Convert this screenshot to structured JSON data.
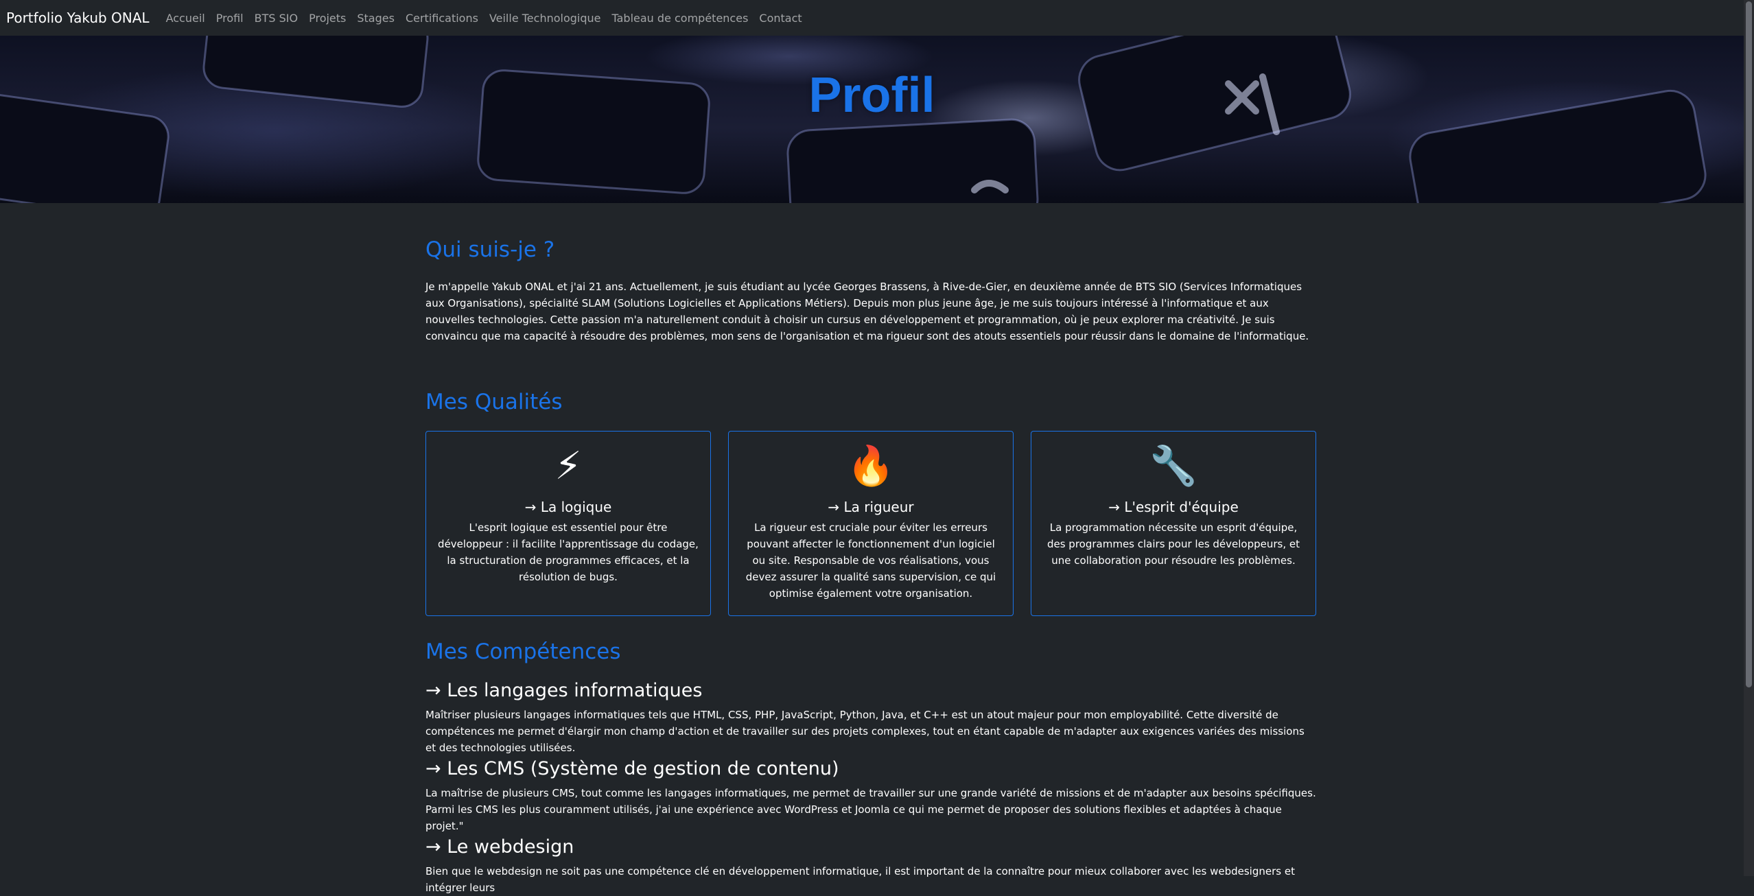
{
  "navbar": {
    "brand": "Portfolio Yakub ONAL",
    "links": [
      "Accueil",
      "Profil",
      "BTS SIO",
      "Projets",
      "Stages",
      "Certifications",
      "Veille Technologique",
      "Tableau de compétences",
      "Contact"
    ]
  },
  "hero": {
    "title": "Profil"
  },
  "about": {
    "title": "Qui suis-je ?",
    "text": "Je m'appelle Yakub ONAL et j'ai 21 ans. Actuellement, je suis étudiant au lycée Georges Brassens, à Rive-de-Gier, en deuxième année de BTS SIO (Services Informatiques aux Organisations), spécialité SLAM (Solutions Logicielles et Applications Métiers). Depuis mon plus jeune âge, je me suis toujours intéressé à l'informatique et aux nouvelles technologies. Cette passion m'a naturellement conduit à choisir un cursus en développement et programmation, où je peux explorer ma créativité. Je suis convaincu que ma capacité à résoudre des problèmes, mon sens de l'organisation et ma rigueur sont des atouts essentiels pour réussir dans le domaine de l'informatique."
  },
  "qualities": {
    "title": "Mes Qualités",
    "cards": [
      {
        "icon": "⚡",
        "icon_name": "lightning-icon",
        "title": "→ La logique",
        "text": "L'esprit logique est essentiel pour être développeur : il facilite l'apprentissage du codage, la structuration de programmes efficaces, et la résolution de bugs."
      },
      {
        "icon": "🔥",
        "icon_name": "fire-icon",
        "title": "→ La rigueur",
        "text": "La rigueur est cruciale pour éviter les erreurs pouvant affecter le fonctionnement d'un logiciel ou site. Responsable de vos réalisations, vous devez assurer la qualité sans supervision, ce qui optimise également votre organisation."
      },
      {
        "icon": "🔧",
        "icon_name": "wrench-icon",
        "title": "→ L'esprit d'équipe",
        "text": "La programmation nécessite un esprit d'équipe, des programmes clairs pour les développeurs, et une collaboration pour résoudre les problèmes."
      }
    ]
  },
  "competences": {
    "title": "Mes Compétences",
    "items": [
      {
        "heading": "→ Les langages informatiques",
        "text": "Maîtriser plusieurs langages informatiques tels que HTML, CSS, PHP, JavaScript, Python, Java, et C++ est un atout majeur pour mon employabilité. Cette diversité de compétences me permet d'élargir mon champ d'action et de travailler sur des projets complexes, tout en étant capable de m'adapter aux exigences variées des missions et des technologies utilisées."
      },
      {
        "heading": "→ Les CMS (Système de gestion de contenu)",
        "text": "La maîtrise de plusieurs CMS, tout comme les langages informatiques, me permet de travailler sur une grande variété de missions et de m'adapter aux besoins spécifiques. Parmi les CMS les plus couramment utilisés, j'ai une expérience avec WordPress et Joomla ce qui me permet de proposer des solutions flexibles et adaptées à chaque projet.\""
      },
      {
        "heading": "→ Le webdesign",
        "text": "Bien que le webdesign ne soit pas une compétence clé en développement informatique, il est important de la connaître pour mieux collaborer avec les webdesigners et intégrer leurs"
      }
    ]
  },
  "colors": {
    "background": "#212529",
    "accent": "#1a73e8",
    "nav_link": "rgba(255,255,255,0.58)"
  }
}
